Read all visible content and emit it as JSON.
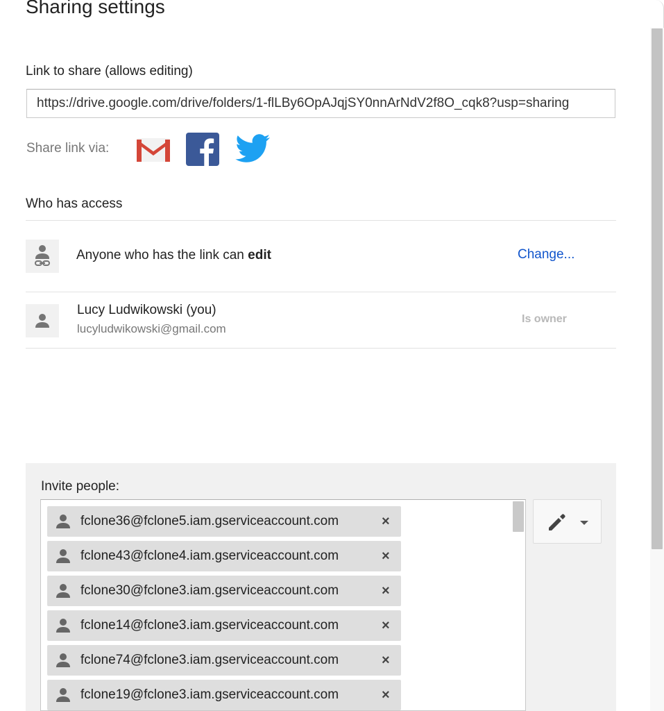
{
  "dialog": {
    "title": "Sharing settings"
  },
  "link": {
    "label": "Link to share (allows editing)",
    "url": "https://drive.google.com/drive/folders/1-flLBy6OpAJqjSY0nnArNdV2f8O_cqk8?usp=sharing"
  },
  "share_via": {
    "label": "Share link via:",
    "icons": [
      "gmail-icon",
      "facebook-icon",
      "twitter-icon"
    ]
  },
  "access": {
    "label": "Who has access",
    "link_access_prefix": "Anyone who has the link can",
    "link_access_level": "edit",
    "change_label": "Change...",
    "owner_name": "Lucy Ludwikowski (you)",
    "owner_email": "lucyludwikowski@gmail.com",
    "owner_role": "Is owner"
  },
  "invite": {
    "label": "Invite people:",
    "chips": [
      "fclone36@fclone5.iam.gserviceaccount.com",
      "fclone43@fclone4.iam.gserviceaccount.com",
      "fclone30@fclone3.iam.gserviceaccount.com",
      "fclone14@fclone3.iam.gserviceaccount.com",
      "fclone74@fclone3.iam.gserviceaccount.com",
      "fclone19@fclone3.iam.gserviceaccount.com"
    ],
    "remove_glyph": "×",
    "permission_icon": "pencil-icon"
  },
  "colors": {
    "link_blue": "#1155cc",
    "gmail_red": "#d44638",
    "facebook_blue": "#3b5998",
    "twitter_blue": "#1da1f2"
  }
}
